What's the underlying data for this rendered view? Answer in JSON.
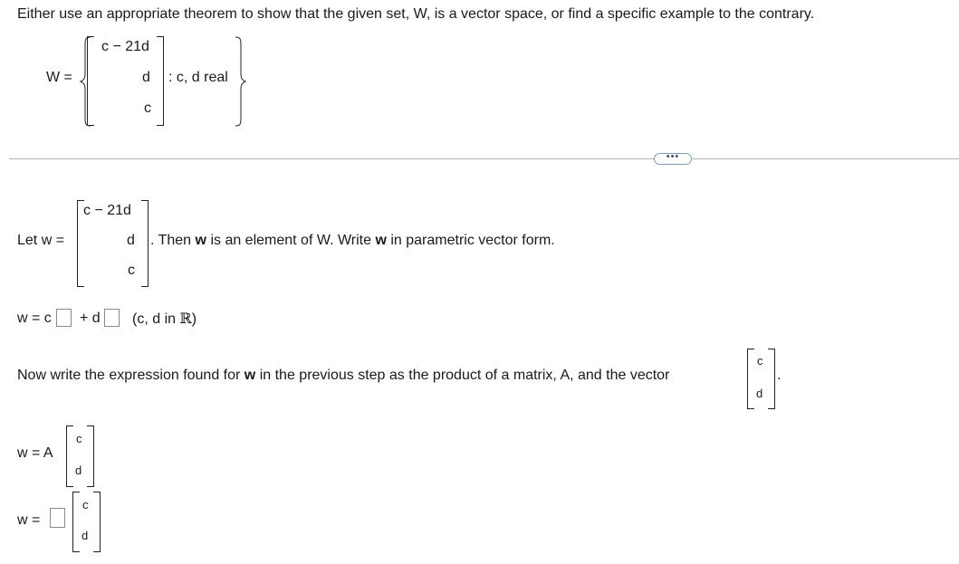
{
  "question": {
    "prompt": "Either use an appropriate theorem to show that the given set, W, is a vector space, or find a specific example to the contrary."
  },
  "set_definition": {
    "lhs": "W =",
    "entries": [
      "c − 21d",
      "d",
      "c"
    ],
    "condition": ": c, d real"
  },
  "more_button": {
    "label": "•••"
  },
  "let_step": {
    "lhs": "Let w =",
    "entries": [
      "c − 21d",
      "d",
      "c"
    ],
    "text_prefix": ". Then",
    "w": "w",
    "text_middle": "is an element of W. Write",
    "text_suffix": "in parametric vector form."
  },
  "parametric": {
    "lhs": "w = c",
    "plus_d": "+ d",
    "note_prefix": "(c, d in",
    "reals": "ℝ",
    "note_suffix": ")"
  },
  "product_instruction": {
    "text_before": "Now write the expression found for",
    "w": "w",
    "text_after": "in the previous step as the product of a matrix, A, and the vector",
    "vector_entries": [
      "c",
      "d"
    ],
    "period": "."
  },
  "w_equals_A": {
    "lhs": "w = A",
    "entries": [
      "c",
      "d"
    ]
  },
  "w_equals_box": {
    "lhs": "w =",
    "entries": [
      "c",
      "d"
    ]
  }
}
